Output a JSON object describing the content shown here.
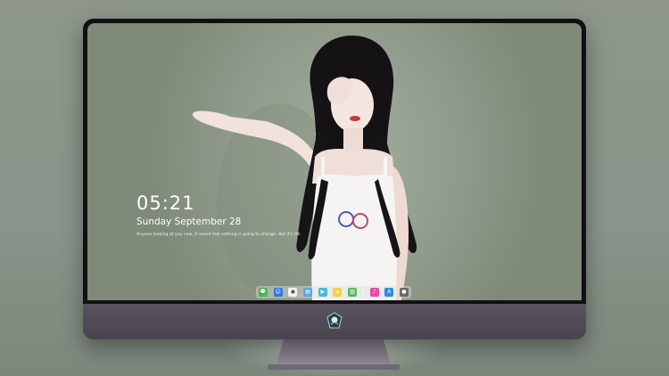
{
  "lockscreen": {
    "time": "05:21",
    "date": "Sunday September  28",
    "tagline": "Anyone looking at you now, it would feel nothing is going to change. But it's OK"
  },
  "dock": {
    "apps": [
      {
        "name": "messages-icon",
        "color": "#3ec24f",
        "glyph": "💬"
      },
      {
        "name": "finder-icon",
        "color": "#2f7ae0",
        "glyph": "☺"
      },
      {
        "name": "chrome-icon",
        "color": "#f2f2f2",
        "glyph": "◉"
      },
      {
        "name": "preview-icon",
        "color": "#5aa8e8",
        "glyph": "▤"
      },
      {
        "name": "clapper-icon",
        "color": "#49b9d9",
        "glyph": "▶"
      },
      {
        "name": "notes-icon",
        "color": "#f5d04a",
        "glyph": "≡"
      },
      {
        "name": "photos-icon",
        "color": "#5cb85c",
        "glyph": "▧"
      },
      {
        "name": "music-icon",
        "color": "#e84aa6",
        "glyph": "♪"
      },
      {
        "name": "appstore-icon",
        "color": "#2b8de8",
        "glyph": "A"
      },
      {
        "name": "camera-icon",
        "color": "#6a6a6a",
        "glyph": "●"
      }
    ]
  },
  "colors": {
    "monitor_body": "#4a4550",
    "bezel": "#111014",
    "wallpaper": "#919c8c"
  }
}
